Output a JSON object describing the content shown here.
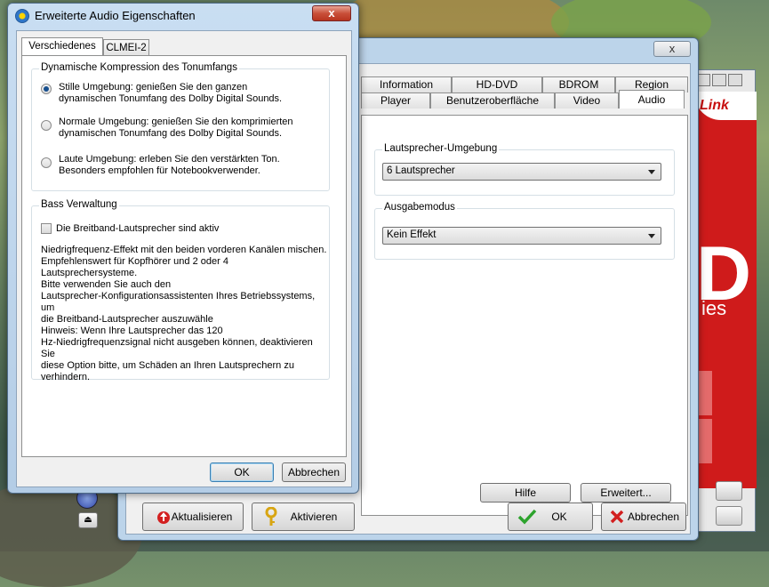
{
  "front_dialog": {
    "title": "Erweiterte Audio Eigenschaften",
    "close_label": "x",
    "tabs": [
      "Verschiedenes",
      "CLMEI-2"
    ],
    "compression": {
      "title": "Dynamische Kompression des Tonumfangs",
      "options": [
        {
          "text": "Stille Umgebung: genießen Sie den ganzen\ndynamischen Tonumfang des Dolby Digital Sounds.",
          "checked": true
        },
        {
          "text": "Normale Umgebung: genießen Sie den komprimierten\ndynamischen Tonumfang des Dolby Digital Sounds.",
          "checked": false
        },
        {
          "text": "Laute Umgebung: erleben Sie den verstärkten Ton.\nBesonders empfohlen für Notebookverwender.",
          "checked": false
        }
      ]
    },
    "bass": {
      "title": "Bass Verwaltung",
      "checkbox_label": "Die Breitband-Lautsprecher sind aktiv",
      "checked": false,
      "para1": "Niedrigfrequenz-Effekt mit den beiden vorderen Kanälen mischen.\nEmpfehlenswert für Kopfhörer und 2 oder 4 Lautsprechersysteme.",
      "para2": "Bitte verwenden Sie auch den\nLautsprecher-Konfigurationsassistenten Ihres Betriebssystems, um\ndie Breitband-Lautsprecher auszuwähle",
      "para3": "Hinweis: Wenn Ihre Lautsprecher das 120\nHz-Niedrigfrequenzsignal nicht ausgeben können, deaktivieren Sie\ndiese Option bitte, um Schäden an Ihren Lautsprechern zu\nverhindern."
    },
    "ok_label": "OK",
    "cancel_label": "Abbrechen"
  },
  "main_dialog": {
    "close_label": "x",
    "tabs_top": [
      "Information",
      "HD-DVD",
      "BDROM",
      "Region"
    ],
    "tabs_bottom": [
      "Player",
      "Benutzeroberfläche",
      "Video",
      "Audio"
    ],
    "active_tab": "Audio",
    "speaker_env": {
      "title": "Lautsprecher-Umgebung",
      "value": "6 Lautsprecher"
    },
    "output_mode": {
      "title": "Ausgabemodus",
      "value": "Kein Effekt"
    },
    "help_label": "Hilfe",
    "advanced_label": "Erweitert...",
    "update_label": "Aktualisieren",
    "activate_label": "Aktivieren",
    "ok_label": "OK",
    "cancel_label": "Abbrechen"
  },
  "background_app": {
    "logo_text": "Link",
    "big_text": "D",
    "sub_text": "ies"
  },
  "colors": {
    "accent_red": "#cf1b1b",
    "ok_green": "#2da32d",
    "cancel_red": "#d21f1f",
    "window_frame": "#b4cde6"
  }
}
